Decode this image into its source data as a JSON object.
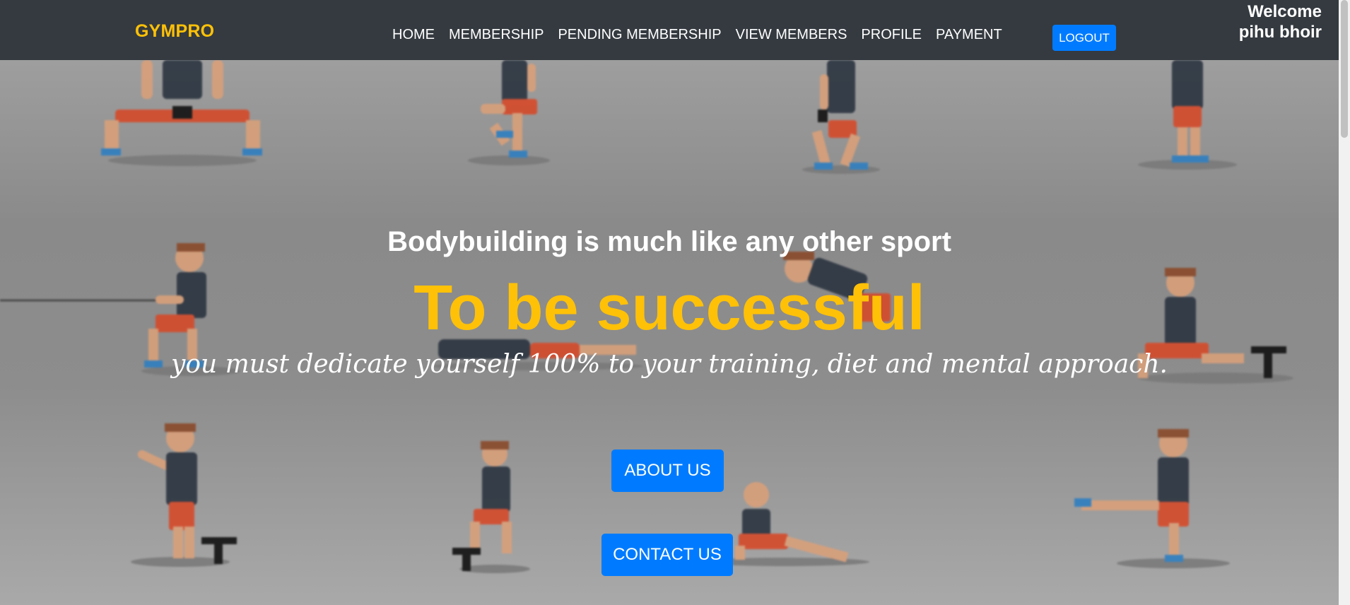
{
  "navbar": {
    "brand": "GYMPRO",
    "links": [
      "HOME",
      "MEMBERSHIP",
      "PENDING MEMBERSHIP",
      "VIEW MEMBERS",
      "PROFILE",
      "PAYMENT"
    ],
    "logout_label": "LOGOUT",
    "welcome_line1": "Welcome",
    "welcome_line2": "pihu bhoir",
    "brand_color": "#ffc107",
    "bg_color": "#343a40"
  },
  "hero": {
    "line1": "Bodybuilding is much like any other sport",
    "line2": "To be successful",
    "line3": "you must dedicate yourself 100% to your training, diet and mental approach.",
    "about_label": "ABOUT US",
    "contact_label": "CONTACT US",
    "accent_color": "#ffc107",
    "button_color": "#007bff",
    "background": "blurred-exercise-figures-image"
  }
}
